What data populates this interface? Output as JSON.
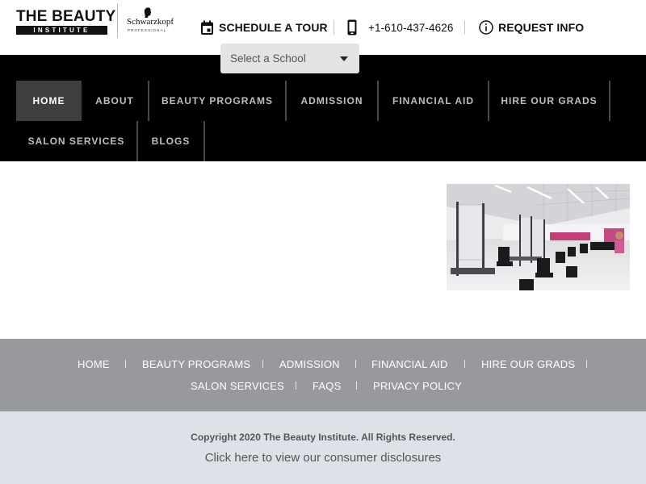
{
  "header": {
    "logo_top": "THE BEAUTY",
    "logo_bottom": "INSTITUTE",
    "partner_name": "Schwarzkopf",
    "partner_sub": "PROFESSIONAL",
    "schedule_tour": "SCHEDULE A TOUR",
    "phone": "+1-610-437-4626",
    "request_info": "REQUEST INFO",
    "select_school_placeholder": "Select a School"
  },
  "nav": {
    "items": [
      {
        "label": "HOME",
        "active": true
      },
      {
        "label": "ABOUT"
      },
      {
        "label": "BEAUTY PROGRAMS"
      },
      {
        "label": "ADMISSION"
      },
      {
        "label": "FINANCIAL AID"
      },
      {
        "label": "HIRE OUR GRADS"
      },
      {
        "label": "SALON SERVICES"
      },
      {
        "label": "BLOGS"
      }
    ]
  },
  "footer": {
    "links": [
      {
        "label": "HOME"
      },
      {
        "label": "BEAUTY PROGRAMS"
      },
      {
        "label": "ADMISSION"
      },
      {
        "label": "FINANCIAL AID"
      },
      {
        "label": "HIRE OUR GRADS"
      },
      {
        "label": "SALON SERVICES"
      },
      {
        "label": "FAQS"
      },
      {
        "label": "PRIVACY POLICY"
      }
    ],
    "copyright": "Copyright 2020 The Beauty Institute. All Rights Reserved.",
    "disclosure": "Click here to view our consumer disclosures"
  },
  "colors": {
    "nav_bg": "#000000",
    "nav_active_bg": "#3e3e3e",
    "footer_nav_bg": "#97999c",
    "footer_bottom_bg": "#dee1e8"
  },
  "icons": {
    "schedule": "calendar-icon",
    "phone": "mobile-phone-icon",
    "info": "info-circle-icon",
    "select": "caret-down-icon"
  }
}
